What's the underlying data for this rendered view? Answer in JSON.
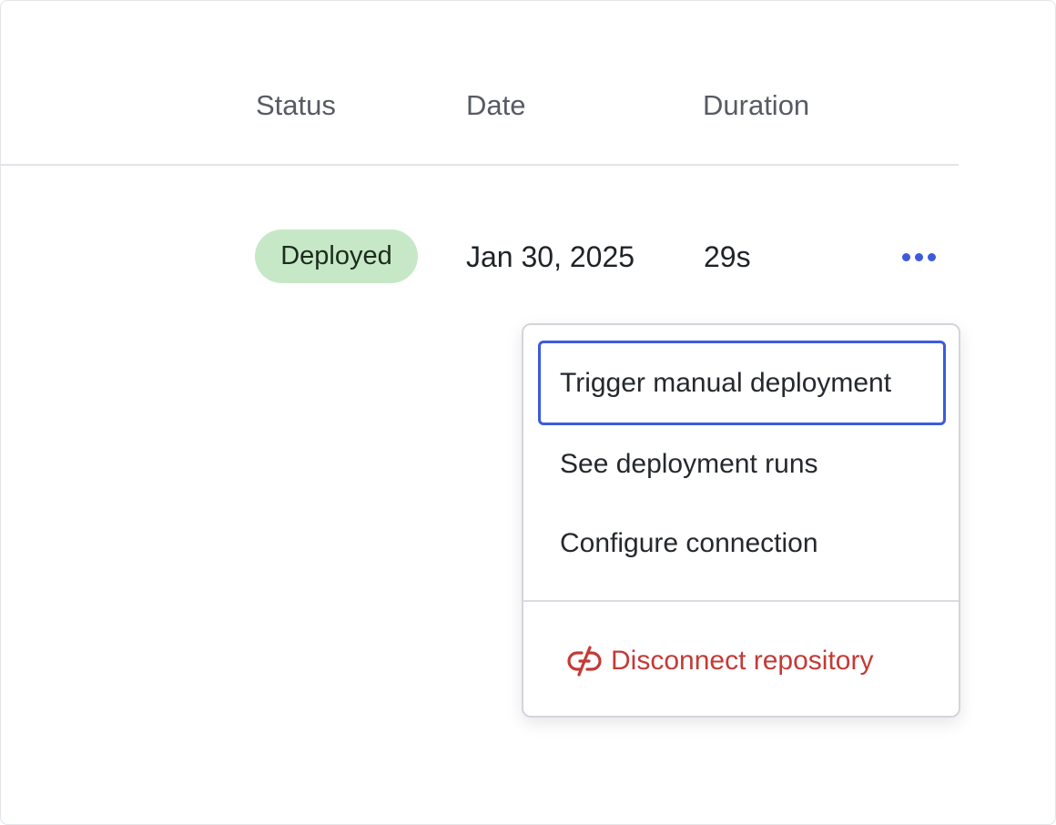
{
  "table": {
    "columns": {
      "status": "Status",
      "date": "Date",
      "duration": "Duration"
    },
    "rows": [
      {
        "status": "Deployed",
        "date": "Jan 30, 2025",
        "duration": "29s"
      }
    ]
  },
  "row_actions": {
    "more_icon": "more-horizontal-icon",
    "menu": {
      "items": [
        {
          "label": "Trigger manual deployment",
          "focused": true
        },
        {
          "label": "See deployment runs"
        },
        {
          "label": "Configure connection"
        }
      ],
      "danger_item": {
        "label": "Disconnect repository",
        "icon": "unlink-icon"
      }
    }
  },
  "colors": {
    "accent": "#3c5bdc",
    "status_deployed_bg": "#c6e8c6",
    "danger": "#c33b36"
  }
}
